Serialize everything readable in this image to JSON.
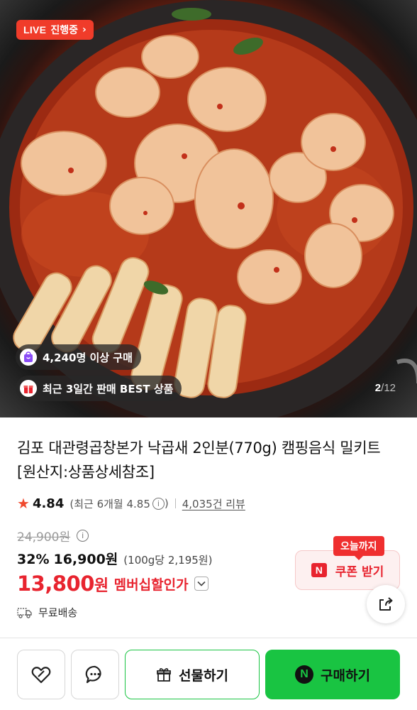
{
  "hero": {
    "live_tag": "LIVE",
    "live_status": "진행중",
    "buyers_badge": "4,240명 이상 구매",
    "best_badge": "최근 3일간 판매 BEST 상품",
    "page_current": "2",
    "page_separator": "/",
    "page_total": "12"
  },
  "product": {
    "title": "김포 대관령곱창본가 낙곱새 2인분(770g) 캠핑음식 밀키트 [원산지:상품상세참조]",
    "rating": "4.84",
    "recent_rating": "(최근 6개월 4.85",
    "recent_rating_close": ")",
    "review_count": "4,035건 리뷰",
    "original_price": "24,900원",
    "discount_rate": "32%",
    "sale_price": "16,900원",
    "unit_price": "(100g당 2,195원)",
    "member_price": "13,800",
    "member_price_unit": "원",
    "member_label": "멤버십할인가",
    "shipping": "무료배송"
  },
  "coupon": {
    "tooltip": "오늘까지",
    "label": "쿠폰 받기",
    "n_mark": "N"
  },
  "bottom_bar": {
    "gift_label": "선물하기",
    "buy_label": "구매하기",
    "buy_mark": "N"
  },
  "colors": {
    "accent_red": "#e8242f",
    "naver_green": "#19c442",
    "live_red": "#f03c2a"
  },
  "icons": {
    "wish": "heart-link-icon",
    "talk": "chat-bubble-icon",
    "gift": "gift-icon",
    "share": "share-icon",
    "shipping": "truck-icon",
    "rating": "star-icon"
  }
}
